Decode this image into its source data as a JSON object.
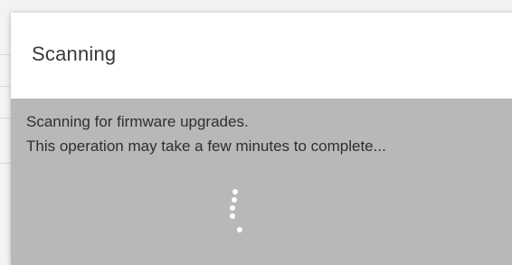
{
  "dialog": {
    "title": "Scanning",
    "message_line1": "Scanning for firmware upgrades.",
    "message_line2": "This operation may take a few minutes to complete..."
  },
  "spinner": {
    "icon": "loading-spinner-icon",
    "color": "#ffffff"
  },
  "colors": {
    "body_background": "#b9b7b7",
    "header_background": "#ffffff",
    "text": "#2f2f2f"
  }
}
